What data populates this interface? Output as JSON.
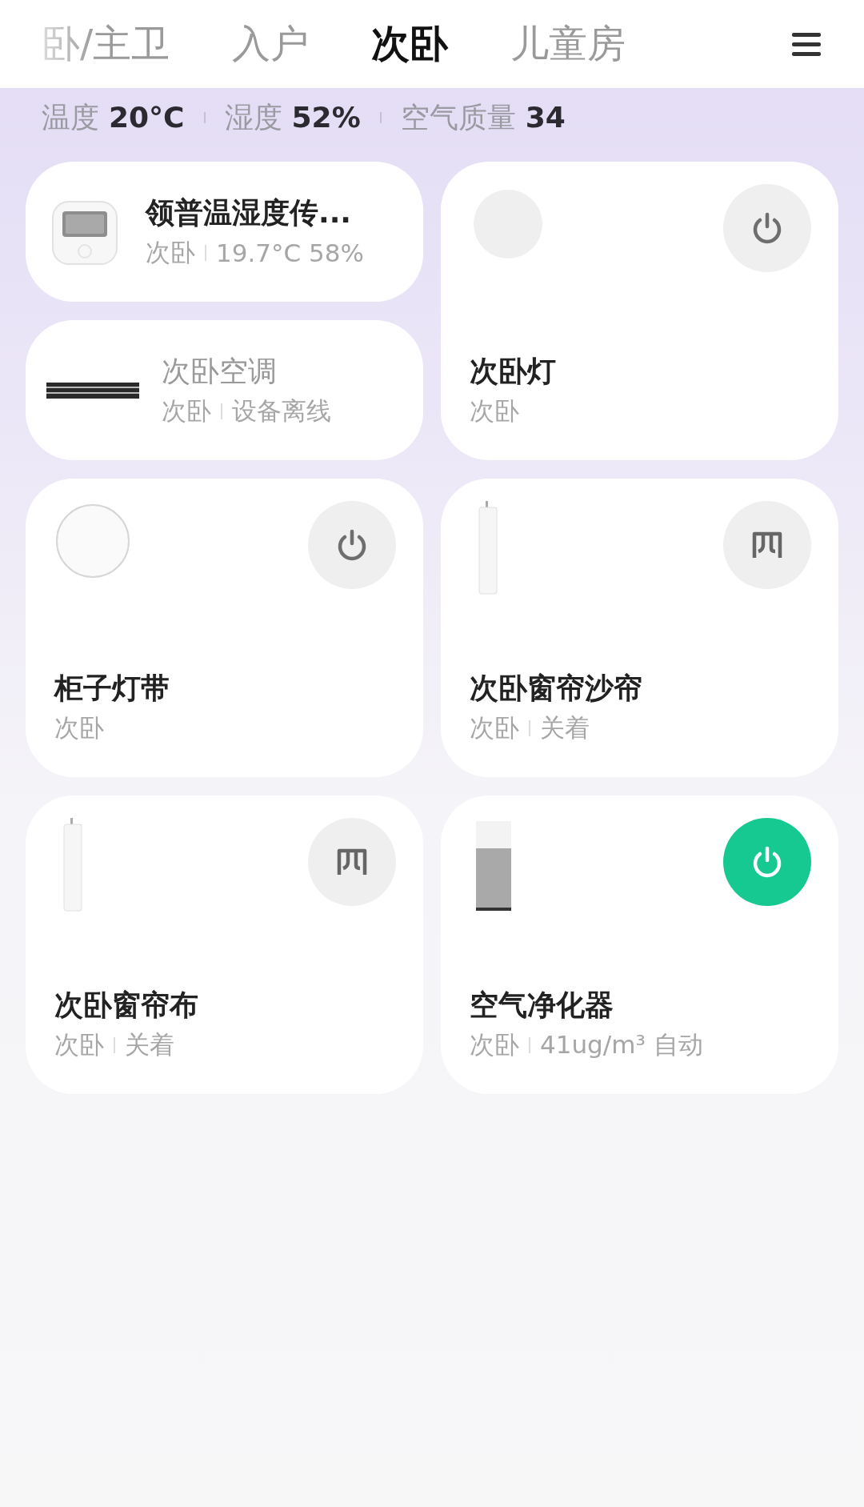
{
  "tabs": [
    {
      "label": "卧/主卫",
      "selected": false
    },
    {
      "label": "入户",
      "selected": false
    },
    {
      "label": "次卧",
      "selected": true
    },
    {
      "label": "儿童房",
      "selected": false
    }
  ],
  "stats": [
    {
      "label": "温度",
      "value": "20°C"
    },
    {
      "label": "湿度",
      "value": "52%"
    },
    {
      "label": "空气质量",
      "value": "34"
    }
  ],
  "devices": [
    {
      "kind": "wide",
      "icon": {
        "kind": "sensor"
      },
      "name": "领普温湿度传...",
      "room": "次卧",
      "status": "19.7°C 58%",
      "offline": false
    },
    {
      "kind": "wide",
      "icon": {
        "kind": "ac"
      },
      "name": "次卧空调",
      "room": "次卧",
      "status": "设备离线",
      "offline": true
    },
    {
      "kind": "tall",
      "icon": {
        "kind": "bulb"
      },
      "name": "次卧灯",
      "room": "次卧",
      "control": {
        "kind": "power",
        "on": false
      },
      "offline": false
    },
    {
      "kind": "tall",
      "icon": {
        "kind": "strip"
      },
      "name": "柜子灯带",
      "room": "次卧",
      "control": {
        "kind": "power",
        "on": false
      },
      "offline": false
    },
    {
      "kind": "tall",
      "icon": {
        "kind": "curtain"
      },
      "name": "次卧窗帘沙帘",
      "room": "次卧",
      "status": "关着",
      "control": {
        "kind": "curtain"
      },
      "offline": false
    },
    {
      "kind": "tall",
      "icon": {
        "kind": "curtain"
      },
      "name": "次卧窗帘布",
      "room": "次卧",
      "status": "关着",
      "control": {
        "kind": "curtain"
      },
      "offline": false
    },
    {
      "kind": "tall",
      "icon": {
        "kind": "purifier"
      },
      "name": "空气净化器",
      "room": "次卧",
      "status": "41ug/m³ 自动",
      "control": {
        "kind": "power",
        "on": true
      },
      "offline": false
    }
  ]
}
